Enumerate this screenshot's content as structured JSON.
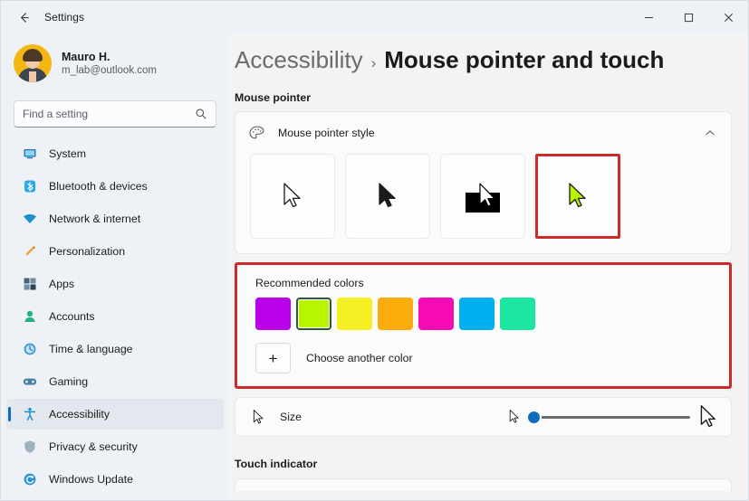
{
  "window": {
    "title": "Settings",
    "back_icon": "back-arrow-icon",
    "controls": {
      "minimize": "minimize-icon",
      "maximize": "maximize-icon",
      "close": "close-icon"
    }
  },
  "account": {
    "name": "Mauro H.",
    "email": "m_lab@outlook.com"
  },
  "search": {
    "placeholder": "Find a setting",
    "value": "",
    "icon": "search-icon"
  },
  "sidebar": {
    "items": [
      {
        "label": "System",
        "icon": "system-icon",
        "active": false
      },
      {
        "label": "Bluetooth & devices",
        "icon": "bluetooth-icon",
        "active": false
      },
      {
        "label": "Network & internet",
        "icon": "network-icon",
        "active": false
      },
      {
        "label": "Personalization",
        "icon": "paintbrush-icon",
        "active": false
      },
      {
        "label": "Apps",
        "icon": "apps-icon",
        "active": false
      },
      {
        "label": "Accounts",
        "icon": "person-icon",
        "active": false
      },
      {
        "label": "Time & language",
        "icon": "clock-icon",
        "active": false
      },
      {
        "label": "Gaming",
        "icon": "gamepad-icon",
        "active": false
      },
      {
        "label": "Accessibility",
        "icon": "accessibility-icon",
        "active": true
      },
      {
        "label": "Privacy & security",
        "icon": "shield-icon",
        "active": false
      },
      {
        "label": "Windows Update",
        "icon": "update-icon",
        "active": false
      }
    ]
  },
  "main": {
    "breadcrumb": {
      "parent": "Accessibility",
      "separator": "›",
      "current": "Mouse pointer and touch"
    },
    "sections": {
      "mouse_pointer_label": "Mouse pointer",
      "touch_indicator_label": "Touch indicator"
    },
    "pointer_style_card": {
      "title": "Mouse pointer style",
      "icon": "palette-icon",
      "expand_icon": "chevron-up-icon",
      "expanded": true,
      "options": [
        {
          "name": "white-pointer",
          "selected": false,
          "annotated": false
        },
        {
          "name": "black-pointer",
          "selected": false,
          "annotated": false
        },
        {
          "name": "inverted-pointer",
          "selected": false,
          "annotated": false
        },
        {
          "name": "custom-pointer",
          "selected": true,
          "annotated": true
        }
      ]
    },
    "colors": {
      "label": "Recommended colors",
      "swatches": [
        {
          "name": "purple",
          "hex": "#BA00E8",
          "selected": false
        },
        {
          "name": "lime",
          "hex": "#B8F500",
          "selected": true
        },
        {
          "name": "yellow",
          "hex": "#F5F023",
          "selected": false
        },
        {
          "name": "amber",
          "hex": "#FAAD0A",
          "selected": false
        },
        {
          "name": "magenta",
          "hex": "#F50AB4",
          "selected": false
        },
        {
          "name": "cyan",
          "hex": "#00B0F0",
          "selected": false
        },
        {
          "name": "spring-green",
          "hex": "#1BE5A0",
          "selected": false
        }
      ],
      "another_color_label": "Choose another color",
      "another_color_icon": "plus-icon",
      "annotation_color": "#CC2B2B"
    },
    "size": {
      "label": "Size",
      "left_icon": "small-cursor-icon",
      "small_icon": "small-cursor-icon",
      "large_icon": "large-cursor-icon",
      "value": 1,
      "min": 1,
      "max": 15,
      "thumb_color": "#0F6CBD"
    }
  },
  "accent_color": "#0F6CBD"
}
